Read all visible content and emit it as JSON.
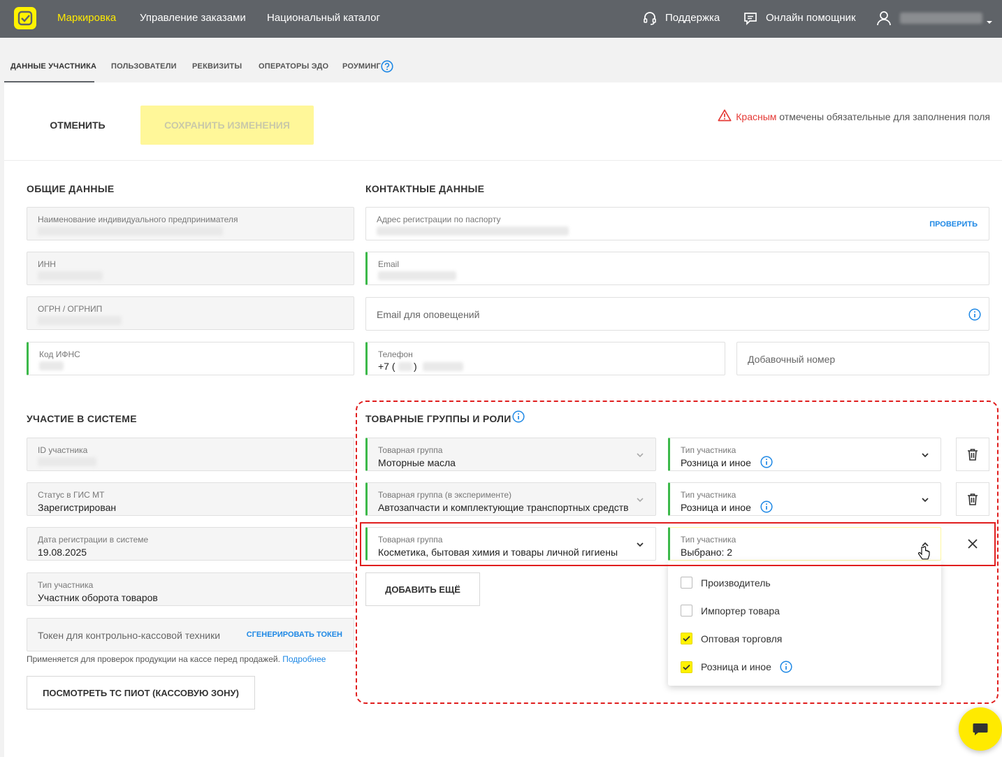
{
  "topbar": {
    "logo": "markirovka-logo-icon",
    "nav": [
      "Маркировка",
      "Управление заказами",
      "Национальный каталог"
    ],
    "support_label": "Поддержка",
    "assistant_label": "Онлайн помощник"
  },
  "tabs": [
    "ДАННЫЕ УЧАСТНИКА",
    "ПОЛЬЗОВАТЕЛИ",
    "РЕКВИЗИТЫ",
    "ОПЕРАТОРЫ ЭДО",
    "РОУМИНГ"
  ],
  "actions": {
    "cancel_label": "ОТМЕНИТЬ",
    "save_label": "СОХРАНИТЬ ИЗМЕНЕНИЯ",
    "required_note_red": "Красным",
    "required_note_rest": " отмечены обязательные для заполнения поля"
  },
  "general": {
    "title": "ОБЩИЕ ДАННЫЕ",
    "name_label": "Наименование индивидуального предпринимателя",
    "inn_label": "ИНН",
    "ogrn_label": "ОГРН / ОГРНИП",
    "ifns_label": "Код ИФНС"
  },
  "contacts": {
    "title": "КОНТАКТНЫЕ ДАННЫЕ",
    "address_label": "Адрес регистрации по паспорту",
    "check_label": "ПРОВЕРИТЬ",
    "email_label": "Email",
    "notify_email_placeholder": "Email для оповещений",
    "phone_label": "Телефон",
    "phone_prefix": "+7 (",
    "phone_close": ")",
    "ext_placeholder": "Добавочный номер"
  },
  "participation": {
    "title": "УЧАСТИЕ В СИСТЕМЕ",
    "id_label": "ID участника",
    "status_label": "Статус в ГИС МТ",
    "status_value": "Зарегистрирован",
    "reg_date_label": "Дата регистрации в системе",
    "reg_date_value": "19.08.2025",
    "type_label": "Тип участника",
    "type_value": "Участник оборота товаров",
    "token_placeholder": "Токен для контрольно-кассовой техники",
    "token_button": "СГЕНЕРИРОВАТЬ ТОКЕН",
    "hint_text": "Применяется для проверок продукции на кассе перед продажей. ",
    "hint_link": "Подробнее",
    "view_pos_button": "ПОСМОТРЕТЬ ТС ПИОТ (КАССОВУЮ ЗОНУ)"
  },
  "product_groups": {
    "title": "ТОВАРНЫЕ ГРУППЫ И РОЛИ",
    "rows": [
      {
        "group_label": "Товарная группа",
        "group_value": "Моторные масла",
        "role_label": "Тип участника",
        "role_value": "Розница и иное"
      },
      {
        "group_label": "Товарная группа (в эксперименте)",
        "group_value": "Автозапчасти и комплектующие транспортных средств",
        "role_label": "Тип участника",
        "role_value": "Розница и иное"
      },
      {
        "group_label": "Товарная группа",
        "group_value": "Косметика, бытовая химия и товары личной гигиены",
        "role_label": "Тип участника",
        "role_value": "Выбрано: 2"
      }
    ],
    "add_more": "ДОБАВИТЬ ЕЩЁ",
    "options": [
      {
        "label": "Производитель",
        "checked": false
      },
      {
        "label": "Импортер товара",
        "checked": false
      },
      {
        "label": "Оптовая торговля",
        "checked": true
      },
      {
        "label": "Розница и иное",
        "checked": true
      }
    ]
  },
  "colors": {
    "topbar": "#5f6368",
    "brand_yellow": "#fff200",
    "required_green": "#3cb94a",
    "link_blue": "#1e88e5",
    "highlight_red": "#e01e1e"
  }
}
